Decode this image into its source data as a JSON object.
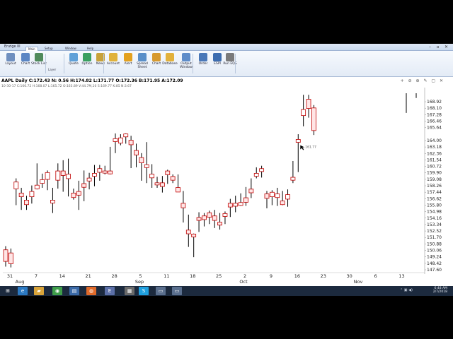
{
  "window": {
    "title": "Enzige III"
  },
  "menu": {
    "tabs": [
      "Main",
      "Setup",
      "Window",
      "Help"
    ],
    "active": "Main"
  },
  "ribbon": {
    "buttons": [
      {
        "label": "Layout",
        "icon": "layout-icon",
        "color": "#6f8fbf"
      },
      {
        "label": "Chart",
        "icon": "chart-icon",
        "color": "#5b86c4"
      },
      {
        "label": "Stock List",
        "icon": "stock-list-icon",
        "color": "#4f8a5b"
      },
      {
        "label": "Quote",
        "icon": "quote-icon",
        "color": "#5fa0d8"
      },
      {
        "label": "Option",
        "icon": "option-icon",
        "color": "#3aa060"
      },
      {
        "label": "News",
        "icon": "news-icon",
        "color": "#c8a23a"
      },
      {
        "label": "Account",
        "icon": "account-icon",
        "color": "#e0b23c"
      },
      {
        "label": "Alert",
        "icon": "alert-icon",
        "color": "#e3a11f"
      },
      {
        "label": "Spread Sheet",
        "icon": "spreadsheet-icon",
        "color": "#5a8fc8"
      },
      {
        "label": "Chart",
        "icon": "chart-window-icon",
        "color": "#d79a2f"
      },
      {
        "label": "Database",
        "icon": "database-icon",
        "color": "#e2b13b"
      },
      {
        "label": "Output Window",
        "icon": "output-window-icon",
        "color": "#5f8dc9"
      },
      {
        "label": "Order",
        "icon": "order-icon",
        "color": "#4a78b8"
      },
      {
        "label": "ESPI",
        "icon": "espi-icon",
        "color": "#3d6db0"
      },
      {
        "label": "Run EQS",
        "icon": "run-eqs-icon",
        "color": "#7a7a7a"
      }
    ],
    "group_label": "Layer"
  },
  "chart": {
    "header": "AAPL Daily C:172.43 N:  0.56 H:174.82 L:171.77 O:172.36 B:171.95 A:172.09",
    "subheader": "10-30-17 C:166.72 H:168.07 L:165.72 O:163.89 V:44.7M,10 S:169.77 K:85 N:3.67",
    "tools": "+ ⊘ ⊕ ✎ ▢ ✕",
    "cursor_label": "161.77"
  },
  "chart_data": {
    "type": "ohlc",
    "title": "AAPL Daily",
    "ylim": [
      147.6,
      170.0
    ],
    "y_ticks": [
      "168.92",
      "168.10",
      "167.28",
      "166.46",
      "165.64",
      "164.00",
      "163.18",
      "162.36",
      "161.54",
      "160.72",
      "159.90",
      "159.08",
      "158.26",
      "157.44",
      "156.62",
      "155.80",
      "154.98",
      "154.16",
      "153.34",
      "152.52",
      "151.70",
      "150.88",
      "150.06",
      "149.24",
      "148.42",
      "147.60"
    ],
    "x_ticks": [
      "31",
      "7",
      "14",
      "21",
      "28",
      "5",
      "11",
      "18",
      "25",
      "2",
      "9",
      "16",
      "23",
      "30",
      "6",
      "13"
    ],
    "months": [
      "Aug",
      "Sep",
      "Oct",
      "Nov"
    ],
    "bars": [
      {
        "o": 150.0,
        "h": 150.6,
        "l": 148.0,
        "c": 148.8
      },
      {
        "o": 149.6,
        "h": 150.3,
        "l": 147.9,
        "c": 148.5
      },
      {
        "o": 158.0,
        "h": 159.2,
        "l": 155.8,
        "c": 158.6
      },
      {
        "o": 157.2,
        "h": 158.0,
        "l": 155.2,
        "c": 157.0
      },
      {
        "o": 156.3,
        "h": 157.0,
        "l": 155.2,
        "c": 156.0
      },
      {
        "o": 157.0,
        "h": 158.3,
        "l": 156.0,
        "c": 157.4
      },
      {
        "o": 158.0,
        "h": 161.1,
        "l": 157.8,
        "c": 158.2
      },
      {
        "o": 158.7,
        "h": 159.8,
        "l": 158.0,
        "c": 158.9
      },
      {
        "o": 159.2,
        "h": 160.2,
        "l": 157.7,
        "c": 159.8
      },
      {
        "o": 156.2,
        "h": 158.0,
        "l": 154.8,
        "c": 156.3
      },
      {
        "o": 159.1,
        "h": 161.1,
        "l": 157.9,
        "c": 160.0
      },
      {
        "o": 160.0,
        "h": 161.5,
        "l": 157.5,
        "c": 159.7
      },
      {
        "o": 159.3,
        "h": 161.7,
        "l": 156.9,
        "c": 159.6
      },
      {
        "o": 157.2,
        "h": 157.9,
        "l": 156.5,
        "c": 156.9
      },
      {
        "o": 157.4,
        "h": 158.9,
        "l": 155.2,
        "c": 157.2
      },
      {
        "o": 158.4,
        "h": 160.2,
        "l": 156.3,
        "c": 158.2
      },
      {
        "o": 159.0,
        "h": 159.9,
        "l": 157.8,
        "c": 159.1
      },
      {
        "o": 159.6,
        "h": 160.9,
        "l": 158.2,
        "c": 159.7
      },
      {
        "o": 160.1,
        "h": 160.9,
        "l": 158.9,
        "c": 160.3
      },
      {
        "o": 160.0,
        "h": 160.8,
        "l": 159.7,
        "c": 160.0
      },
      {
        "o": 160.0,
        "h": 163.2,
        "l": 159.7,
        "c": 159.9
      },
      {
        "o": 164.0,
        "h": 164.9,
        "l": 162.4,
        "c": 164.1
      },
      {
        "o": 163.8,
        "h": 164.8,
        "l": 163.4,
        "c": 164.2
      },
      {
        "o": 164.6,
        "h": 164.9,
        "l": 163.6,
        "c": 164.7
      },
      {
        "o": 163.9,
        "h": 164.6,
        "l": 160.5,
        "c": 163.6
      },
      {
        "o": 162.6,
        "h": 163.6,
        "l": 160.6,
        "c": 162.3
      },
      {
        "o": 161.7,
        "h": 162.4,
        "l": 158.9,
        "c": 161.3
      },
      {
        "o": 160.7,
        "h": 163.8,
        "l": 158.6,
        "c": 160.8
      },
      {
        "o": 159.4,
        "h": 161.0,
        "l": 158.0,
        "c": 159.6
      },
      {
        "o": 158.5,
        "h": 159.4,
        "l": 158.0,
        "c": 158.5
      },
      {
        "o": 158.5,
        "h": 159.5,
        "l": 157.4,
        "c": 158.3
      },
      {
        "o": 160.0,
        "h": 160.3,
        "l": 158.5,
        "c": 159.8
      },
      {
        "o": 159.3,
        "h": 159.7,
        "l": 158.6,
        "c": 159.1
      },
      {
        "o": 157.9,
        "h": 159.7,
        "l": 157.5,
        "c": 157.6
      },
      {
        "o": 155.9,
        "h": 157.6,
        "l": 153.6,
        "c": 155.6
      },
      {
        "o": 152.5,
        "h": 154.6,
        "l": 150.5,
        "c": 152.3
      },
      {
        "o": 152.0,
        "h": 152.2,
        "l": 149.2,
        "c": 151.9
      },
      {
        "o": 154.1,
        "h": 154.9,
        "l": 152.4,
        "c": 154.0
      },
      {
        "o": 154.3,
        "h": 154.8,
        "l": 153.1,
        "c": 154.1
      },
      {
        "o": 154.7,
        "h": 155.1,
        "l": 153.4,
        "c": 154.4
      },
      {
        "o": 154.3,
        "h": 155.2,
        "l": 152.9,
        "c": 154.0
      },
      {
        "o": 153.5,
        "h": 154.8,
        "l": 152.7,
        "c": 153.4
      },
      {
        "o": 154.5,
        "h": 155.0,
        "l": 153.4,
        "c": 154.6
      },
      {
        "o": 155.9,
        "h": 156.6,
        "l": 154.3,
        "c": 155.7
      },
      {
        "o": 155.8,
        "h": 157.0,
        "l": 154.9,
        "c": 155.9
      },
      {
        "o": 155.9,
        "h": 157.3,
        "l": 155.7,
        "c": 156.0
      },
      {
        "o": 156.6,
        "h": 158.1,
        "l": 155.7,
        "c": 156.3
      },
      {
        "o": 157.7,
        "h": 159.2,
        "l": 156.7,
        "c": 157.5
      },
      {
        "o": 159.6,
        "h": 160.6,
        "l": 159.2,
        "c": 159.7
      },
      {
        "o": 160.2,
        "h": 160.8,
        "l": 159.3,
        "c": 160.3
      },
      {
        "o": 157.1,
        "h": 157.6,
        "l": 155.4,
        "c": 156.8
      },
      {
        "o": 157.0,
        "h": 157.7,
        "l": 155.8,
        "c": 157.3
      },
      {
        "o": 156.9,
        "h": 158.0,
        "l": 155.7,
        "c": 157.1
      },
      {
        "o": 156.2,
        "h": 157.6,
        "l": 155.8,
        "c": 156.0
      },
      {
        "o": 156.7,
        "h": 157.8,
        "l": 155.6,
        "c": 157.0
      },
      {
        "o": 159.1,
        "h": 161.4,
        "l": 158.6,
        "c": 159.2
      },
      {
        "o": 163.9,
        "h": 164.8,
        "l": 160.0,
        "c": 164.0
      },
      {
        "o": 167.3,
        "h": 169.8,
        "l": 165.8,
        "c": 167.8
      },
      {
        "o": 169.1,
        "h": 169.8,
        "l": 166.9,
        "c": 168.2
      },
      {
        "o": 168.0,
        "h": 168.5,
        "l": 164.7,
        "c": 165.4
      }
    ],
    "late_bars": [
      {
        "o": 169.8,
        "h": 170.0,
        "l": 167.5,
        "c": 168.7
      },
      {
        "o": 169.9,
        "h": 170.0,
        "l": 169.4,
        "c": 169.9
      }
    ]
  },
  "taskbar": {
    "items": [
      {
        "name": "start-button",
        "glyph": "⊞",
        "color": "#1c2a3e"
      },
      {
        "name": "ie-icon",
        "glyph": "e",
        "color": "#2b79c2"
      },
      {
        "name": "explorer-icon",
        "glyph": "▰",
        "color": "#d9a43a"
      },
      {
        "name": "chrome-icon",
        "glyph": "◉",
        "color": "#3f9e4a"
      },
      {
        "name": "store-icon",
        "glyph": "▤",
        "color": "#3b6aa8"
      },
      {
        "name": "firefox-icon",
        "glyph": "◍",
        "color": "#e06a2a"
      },
      {
        "name": "enzige-icon",
        "glyph": "E",
        "color": "#5b6fa8"
      },
      {
        "name": "app-icon",
        "glyph": "▦",
        "color": "#6a6a6a"
      },
      {
        "name": "skype-icon",
        "glyph": "S",
        "color": "#1fa0df"
      },
      {
        "name": "window-a-icon",
        "glyph": "▭",
        "color": "#5a6f8e"
      },
      {
        "name": "window-b-icon",
        "glyph": "▭",
        "color": "#5a6f8e"
      }
    ],
    "tray": "⌃  ▣  ◀)",
    "time": "6:48 AM",
    "date": "2/7/2018"
  }
}
